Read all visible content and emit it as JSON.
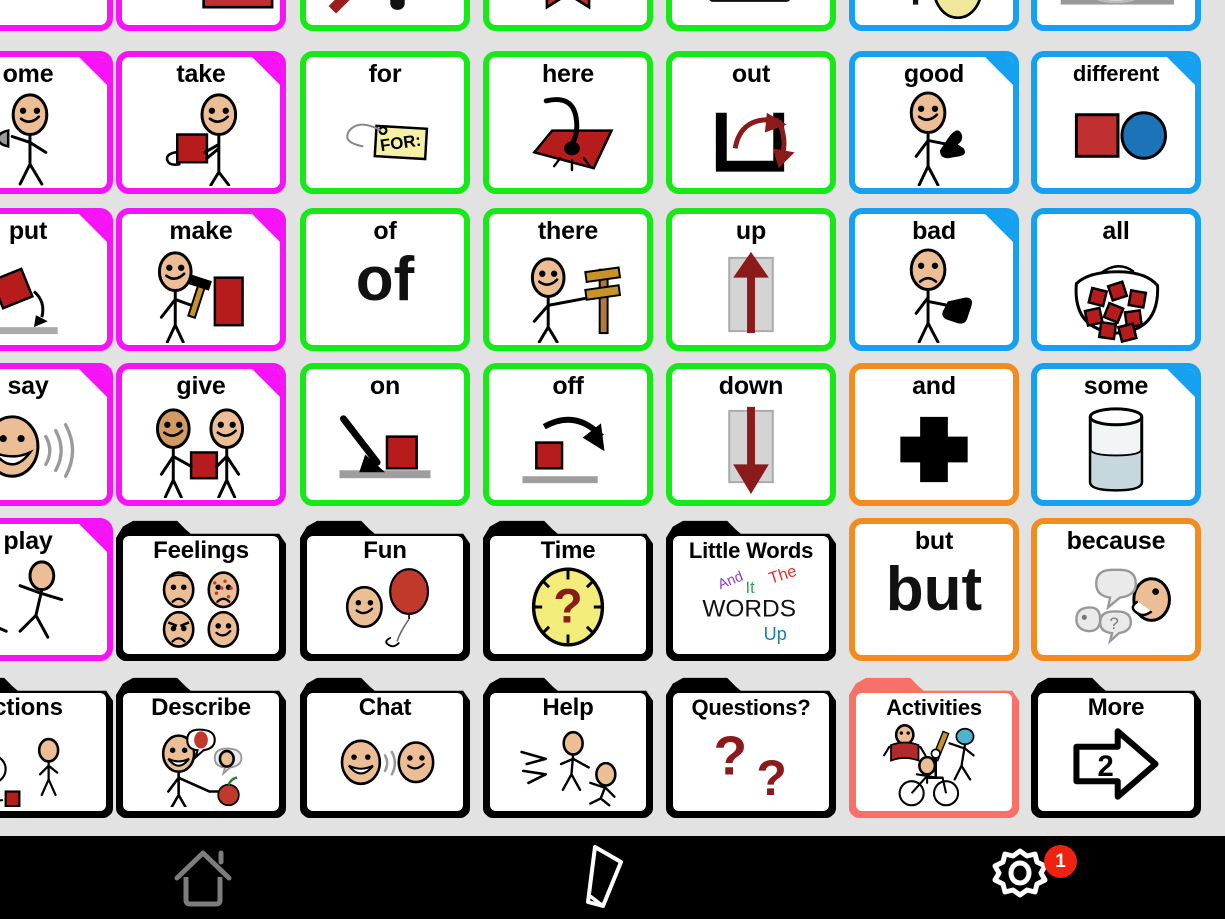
{
  "app": {
    "background_color": "#e2e2e2",
    "grid_columns": 7,
    "grid_rows": 6
  },
  "colors": {
    "magenta": "#F713F7",
    "green": "#17E817",
    "blue": "#16A0F0",
    "orange": "#F28C1E",
    "black": "#000000",
    "salmon": "#F97068",
    "badge_red": "#EE2211"
  },
  "grid": {
    "row0_partial_note": "Top row is cut off by the top edge of the screen; only the lower part of the symbol art is visible and no labels are readable.",
    "rows": [
      {
        "row": 0,
        "clipped": true,
        "cells": [
          {
            "label": "",
            "border": "magenta",
            "style": "plain",
            "icon": "partial-art-topclip"
          },
          {
            "label": "",
            "border": "magenta",
            "style": "plain",
            "icon": "partial-art-topclip"
          },
          {
            "label": "",
            "border": "green",
            "style": "plain",
            "icon": "partial-art-topclip"
          },
          {
            "label": "",
            "border": "green",
            "style": "plain",
            "icon": "partial-art-topclip"
          },
          {
            "label": "",
            "border": "green",
            "style": "plain",
            "icon": "partial-art-topclip"
          },
          {
            "label": "",
            "border": "blue",
            "style": "plain",
            "icon": "partial-art-topclip"
          },
          {
            "label": "",
            "border": "blue",
            "style": "plain",
            "icon": "partial-art-topclip"
          }
        ]
      },
      {
        "row": 1,
        "cells": [
          {
            "label": "come",
            "clipped_label": "ome",
            "border": "magenta",
            "style": "plain",
            "fold": true,
            "icon": "person-beckoning"
          },
          {
            "label": "take",
            "border": "magenta",
            "style": "plain",
            "fold": true,
            "icon": "person-taking-block"
          },
          {
            "label": "for",
            "border": "green",
            "style": "plain",
            "fold": false,
            "icon": "for-tag"
          },
          {
            "label": "here",
            "border": "green",
            "style": "plain",
            "fold": false,
            "icon": "hand-pointing-down-at-mat"
          },
          {
            "label": "out",
            "border": "green",
            "style": "plain",
            "fold": false,
            "icon": "arrow-out-of-box"
          },
          {
            "label": "good",
            "border": "blue",
            "style": "plain",
            "fold": true,
            "icon": "thumbs-up-person"
          },
          {
            "label": "different",
            "border": "blue",
            "style": "plain",
            "fold": true,
            "icon": "red-square-blue-circle"
          }
        ]
      },
      {
        "row": 2,
        "cells": [
          {
            "label": "put",
            "border": "magenta",
            "style": "plain",
            "fold": true,
            "icon": "hand-putting-block-down"
          },
          {
            "label": "make",
            "border": "magenta",
            "style": "plain",
            "fold": true,
            "icon": "person-hammering"
          },
          {
            "label": "of",
            "border": "green",
            "style": "plain",
            "fold": false,
            "icon": "word-of",
            "word_glyph": "of"
          },
          {
            "label": "there",
            "border": "green",
            "style": "plain",
            "fold": false,
            "icon": "person-pointing-at-signpost"
          },
          {
            "label": "up",
            "border": "green",
            "style": "plain",
            "fold": false,
            "icon": "up-arrow-in-box"
          },
          {
            "label": "bad",
            "border": "blue",
            "style": "plain",
            "fold": true,
            "icon": "thumbs-down-person"
          },
          {
            "label": "all",
            "border": "blue",
            "style": "plain",
            "fold": false,
            "icon": "bag-full-of-blocks"
          }
        ]
      },
      {
        "row": 3,
        "cells": [
          {
            "label": "say",
            "border": "magenta",
            "style": "plain",
            "fold": true,
            "icon": "talking-face-with-sound-waves"
          },
          {
            "label": "give",
            "border": "magenta",
            "style": "plain",
            "fold": true,
            "icon": "two-people-exchanging-block"
          },
          {
            "label": "on",
            "border": "green",
            "style": "plain",
            "fold": false,
            "icon": "arrow-onto-block"
          },
          {
            "label": "off",
            "border": "green",
            "style": "plain",
            "fold": false,
            "icon": "arrow-off-block"
          },
          {
            "label": "down",
            "border": "green",
            "style": "plain",
            "fold": false,
            "icon": "down-arrow-in-box"
          },
          {
            "label": "and",
            "border": "orange",
            "style": "plain",
            "fold": false,
            "icon": "plus-sign"
          },
          {
            "label": "some",
            "border": "blue",
            "style": "plain",
            "fold": true,
            "icon": "glass-half-full"
          }
        ]
      },
      {
        "row": 4,
        "cells": [
          {
            "label": "play",
            "border": "magenta",
            "style": "plain",
            "fold": true,
            "icon": "children-playing"
          },
          {
            "label": "Feelings",
            "border": "black",
            "style": "folder",
            "icon": "four-emotion-faces"
          },
          {
            "label": "Fun",
            "border": "black",
            "style": "folder",
            "icon": "face-with-balloon"
          },
          {
            "label": "Time",
            "border": "black",
            "style": "folder",
            "icon": "clock-with-question-mark"
          },
          {
            "label": "Little Words",
            "border": "black",
            "style": "folder",
            "icon": "word-cloud",
            "word_cloud": [
              {
                "text": "And",
                "color": "#8B3FC2"
              },
              {
                "text": "It",
                "color": "#2FA84F"
              },
              {
                "text": "The",
                "color": "#E8302A"
              },
              {
                "text": "WORDS",
                "color": "#111111"
              },
              {
                "text": "Up",
                "color": "#1B7FA8"
              }
            ]
          },
          {
            "label": "but",
            "border": "orange",
            "style": "plain",
            "fold": false,
            "icon": "word-but",
            "word_glyph": "but"
          },
          {
            "label": "because",
            "border": "orange",
            "style": "plain",
            "fold": false,
            "icon": "speech-bubbles-question"
          }
        ]
      },
      {
        "row": 5,
        "cells": [
          {
            "label": "Actions",
            "clipped_label": "ctions",
            "border": "black",
            "style": "folder",
            "icon": "people-doing-actions"
          },
          {
            "label": "Describe",
            "border": "black",
            "style": "folder",
            "icon": "person-pointing-at-apple"
          },
          {
            "label": "Chat",
            "border": "black",
            "style": "folder",
            "icon": "two-faces-talking"
          },
          {
            "label": "Help",
            "border": "black",
            "style": "folder",
            "icon": "person-helping-person-up"
          },
          {
            "label": "Questions?",
            "border": "black",
            "style": "folder",
            "icon": "two-question-marks"
          },
          {
            "label": "Activities",
            "border": "salmon",
            "style": "folder",
            "icon": "reading-biking-baseball",
            "selected": true
          },
          {
            "label": "More",
            "border": "black",
            "style": "folder",
            "icon": "arrow-right-page-2",
            "page_number": "2"
          }
        ]
      }
    ]
  },
  "toolbar": {
    "background_color": "#000000",
    "buttons": [
      {
        "name": "home",
        "icon": "home-icon",
        "label": ""
      },
      {
        "name": "edit",
        "icon": "pencil-icon",
        "label": ""
      },
      {
        "name": "settings",
        "icon": "gear-icon",
        "label": "",
        "badge": "1"
      }
    ]
  }
}
